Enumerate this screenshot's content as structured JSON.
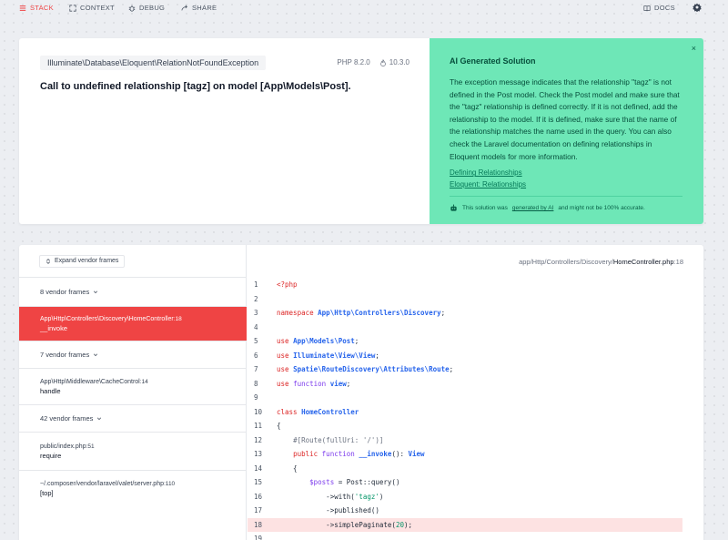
{
  "nav": {
    "stack": "Stack",
    "context": "Context",
    "debug": "Debug",
    "share": "Share",
    "docs": "Docs"
  },
  "error": {
    "exception_class": "Illuminate\\Database\\Eloquent\\RelationNotFoundException",
    "php_version": "PHP 8.2.0",
    "laravel_version": "10.3.0",
    "message": "Call to undefined relationship [tagz] on model [App\\Models\\Post]."
  },
  "ai": {
    "close": "×",
    "title": "AI Generated Solution",
    "body": "The exception message indicates that the relationship \"tagz\" is not defined in the Post model. Check the Post model and make sure that the \"tagz\" relationship is defined correctly. If it is not defined, add the relationship to the model. If it is defined, make sure that the name of the relationship matches the name used in the query. You can also check the Laravel documentation on defining relationships in Eloquent models for more information.",
    "links": [
      "Defining Relationships",
      "Eloquent: Relationships"
    ],
    "footer_pre": "This solution was",
    "footer_link": "generated by AI",
    "footer_post": "and might not be 100% accurate."
  },
  "frames": {
    "expand_label": "Expand vendor frames",
    "items": [
      {
        "vendor": "8 vendor frames"
      },
      {
        "path": "App\\Http\\Controllers\\Discovery\\HomeController",
        "line": ":18",
        "method": "__invoke",
        "active": true
      },
      {
        "vendor": "7 vendor frames"
      },
      {
        "path": "App\\Http\\Middleware\\CacheControl",
        "line": ":14",
        "method": "handle"
      },
      {
        "vendor": "42 vendor frames"
      },
      {
        "path": "public/index.php",
        "line": ":51",
        "method": "require"
      },
      {
        "path": "~/.composer/vendor/laravel/valet/server.php",
        "line": ":110",
        "method": "[top]"
      }
    ]
  },
  "code": {
    "file_dir": "app/Http/Controllers/Discovery/",
    "file_name": "HomeController.php",
    "file_line": ":18",
    "highlight_line": 18,
    "line_numbers": [
      "1",
      "2",
      "3",
      "4",
      "5",
      "6",
      "7",
      "8",
      "9",
      "10",
      "11",
      "12",
      "13",
      "14",
      "15",
      "16",
      "17",
      "18",
      "19"
    ]
  }
}
